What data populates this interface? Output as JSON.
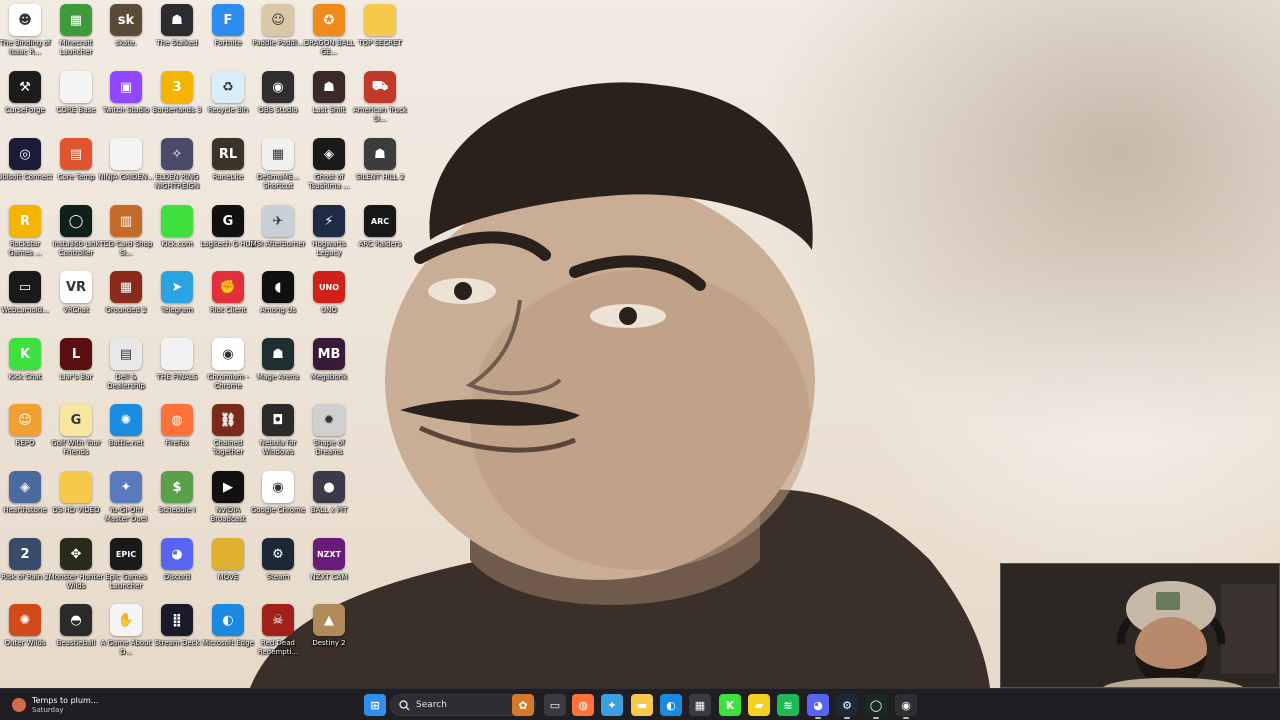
{
  "desktop": {
    "icons": [
      {
        "label": "The Binding of Isaac R...",
        "icon": "isaac-icon",
        "color": "#ffffff",
        "glyph": "☻"
      },
      {
        "label": "Minecraft Launcher",
        "icon": "minecraft-icon",
        "color": "#3e9a3a",
        "glyph": "▦"
      },
      {
        "label": "skate.",
        "icon": "skate-icon",
        "color": "#5a4a3a",
        "glyph": "sk"
      },
      {
        "label": "The Stalked",
        "icon": "stalked-icon",
        "color": "#2b2b30",
        "glyph": "☗"
      },
      {
        "label": "Fortnite",
        "icon": "fortnite-icon",
        "color": "#2d8cf0",
        "glyph": "F"
      },
      {
        "label": "Paddle Paddl...",
        "icon": "paddle-icon",
        "color": "#d8c8a8",
        "glyph": "☺"
      },
      {
        "label": "DRAGON BALL GE...",
        "icon": "dragonball-icon",
        "color": "#f08a1a",
        "glyph": "✪"
      },
      {
        "label": "TOP SECRET",
        "icon": "folder-icon",
        "color": "#f6c94a",
        "glyph": ""
      },
      {
        "label": "CurseForge",
        "icon": "curseforge-icon",
        "color": "#1c1c1c",
        "glyph": "⚒"
      },
      {
        "label": "CORE Base",
        "icon": "file-icon",
        "color": "#f4f4f4",
        "glyph": ""
      },
      {
        "label": "Twitch Studio",
        "icon": "twitch-icon",
        "color": "#9146ff",
        "glyph": "▣"
      },
      {
        "label": "Borderlands 3",
        "icon": "borderlands-icon",
        "color": "#f4b400",
        "glyph": "3"
      },
      {
        "label": "Recycle Bin",
        "icon": "recycle-bin-icon",
        "color": "#d9eef9",
        "glyph": "♻"
      },
      {
        "label": "OBS Studio",
        "icon": "obs-icon",
        "color": "#302e31",
        "glyph": "◉"
      },
      {
        "label": "Last Shift",
        "icon": "lastshift-icon",
        "color": "#3a2a2a",
        "glyph": "☗"
      },
      {
        "label": "American Truck Si...",
        "icon": "truck-icon",
        "color": "#c0392b",
        "glyph": "⛟"
      },
      {
        "label": "Ubisoft Connect",
        "icon": "ubisoft-icon",
        "color": "#1b1b3a",
        "glyph": "◎"
      },
      {
        "label": "Core Temp",
        "icon": "coretemp-icon",
        "color": "#e0542f",
        "glyph": "▤"
      },
      {
        "label": "NINJA GAIDEN...",
        "icon": "file-icon",
        "color": "#f4f4f4",
        "glyph": ""
      },
      {
        "label": "ELDEN RING NIGHTREIGN",
        "icon": "eldenring-icon",
        "color": "#4a4a6a",
        "glyph": "✧"
      },
      {
        "label": "RuneLite",
        "icon": "runelite-icon",
        "color": "#3a3328",
        "glyph": "RL"
      },
      {
        "label": "DeSmuME... Shortcut",
        "icon": "desmume-icon",
        "color": "#f0f0f0",
        "glyph": "▦"
      },
      {
        "label": "Ghost of Tsushima ...",
        "icon": "ghost-icon",
        "color": "#1a1a1a",
        "glyph": "◈"
      },
      {
        "label": "SILENT HILL 2",
        "icon": "silenthill-icon",
        "color": "#3c3c3c",
        "glyph": "☗"
      },
      {
        "label": "Rockstar Games ...",
        "icon": "rockstar-icon",
        "color": "#f4b400",
        "glyph": "R"
      },
      {
        "label": "Insta360 Link Controller",
        "icon": "insta360-icon",
        "color": "#0f1f1a",
        "glyph": "◯"
      },
      {
        "label": "TCG Card Shop Si...",
        "icon": "tcg-icon",
        "color": "#c46a2a",
        "glyph": "▥"
      },
      {
        "label": "Kick.com",
        "icon": "kick-icon",
        "color": "#3ee03e",
        "glyph": ""
      },
      {
        "label": "Logitech G HUB",
        "icon": "logitech-icon",
        "color": "#111111",
        "glyph": "G"
      },
      {
        "label": "MSI Afterburner",
        "icon": "msi-icon",
        "color": "#c8d0d8",
        "glyph": "✈"
      },
      {
        "label": "Hogwarts Legacy",
        "icon": "hogwarts-icon",
        "color": "#1f2a44",
        "glyph": "⚡"
      },
      {
        "label": "ARC Raiders",
        "icon": "arc-icon",
        "color": "#181818",
        "glyph": "ARC"
      },
      {
        "label": "Webcamoid...",
        "icon": "webcamoid-icon",
        "color": "#1a1a1a",
        "glyph": "▭"
      },
      {
        "label": "VRChat",
        "icon": "vrchat-icon",
        "color": "#ffffff",
        "glyph": "VR"
      },
      {
        "label": "Grounded 2",
        "icon": "grounded-icon",
        "color": "#8a2a1a",
        "glyph": "▦"
      },
      {
        "label": "Telegram",
        "icon": "telegram-icon",
        "color": "#2aa3e0",
        "glyph": "➤"
      },
      {
        "label": "Riot Client",
        "icon": "riot-icon",
        "color": "#e3313c",
        "glyph": "✊"
      },
      {
        "label": "Among Us",
        "icon": "amongus-icon",
        "color": "#101010",
        "glyph": "◖"
      },
      {
        "label": "UNO",
        "icon": "uno-icon",
        "color": "#d0201a",
        "glyph": "UNO"
      },
      {
        "label": "Kick Chat",
        "icon": "kickchat-icon",
        "color": "#3ee03e",
        "glyph": "K"
      },
      {
        "label": "Liar's Bar",
        "icon": "liarsbar-icon",
        "color": "#5a1010",
        "glyph": "L"
      },
      {
        "label": "Dell & Dealership",
        "icon": "dell-icon",
        "color": "#e8e8e8",
        "glyph": "▤"
      },
      {
        "label": "THE FINALS",
        "icon": "finals-icon",
        "color": "#f2f2f2",
        "glyph": ""
      },
      {
        "label": "Chromium - Chrome",
        "icon": "chromium-icon",
        "color": "#ffffff",
        "glyph": "◉"
      },
      {
        "label": "Mage Arena",
        "icon": "magearena-icon",
        "color": "#1f2f2f",
        "glyph": "☗"
      },
      {
        "label": "Megabonk",
        "icon": "megabonk-icon",
        "color": "#3a1a3a",
        "glyph": "MB"
      },
      {
        "label": "REPO",
        "icon": "repo-icon",
        "color": "#f0a030",
        "glyph": "☺"
      },
      {
        "label": "Golf With Your Friends",
        "icon": "golf-icon",
        "color": "#f7e7a0",
        "glyph": "G"
      },
      {
        "label": "Battle.net",
        "icon": "battlenet-icon",
        "color": "#1a8ce0",
        "glyph": "✺"
      },
      {
        "label": "Firefox",
        "icon": "firefox-icon",
        "color": "#ff7139",
        "glyph": "◍"
      },
      {
        "label": "Chained Together",
        "icon": "chained-icon",
        "color": "#7a2a1a",
        "glyph": "⛓"
      },
      {
        "label": "Nebula for Windows",
        "icon": "nebula-icon",
        "color": "#2a2a2a",
        "glyph": "◘"
      },
      {
        "label": "Shape of Dreams",
        "icon": "shape-icon",
        "color": "#d0d0d0",
        "glyph": "✹"
      },
      {
        "label": "Hearthstone",
        "icon": "hearthstone-icon",
        "color": "#4a6aa0",
        "glyph": "◈"
      },
      {
        "label": "DS HD VIDEO",
        "icon": "folder-icon",
        "color": "#f6c94a",
        "glyph": ""
      },
      {
        "label": "Yu-Gi-Oh! Master Duel",
        "icon": "yugioh-icon",
        "color": "#5a7ac0",
        "glyph": "✦"
      },
      {
        "label": "Schedule I",
        "icon": "schedule-icon",
        "color": "#5aa04a",
        "glyph": "$"
      },
      {
        "label": "NVIDIA Broadcast",
        "icon": "nvidia-icon",
        "color": "#111111",
        "glyph": "▶"
      },
      {
        "label": "Google Chrome",
        "icon": "chrome-icon",
        "color": "#ffffff",
        "glyph": "◉"
      },
      {
        "label": "BALL x PIT",
        "icon": "ballxpit-icon",
        "color": "#3a3a4a",
        "glyph": "●"
      },
      {
        "label": "Risk of Rain 2",
        "icon": "riskofrain-icon",
        "color": "#3a4a6a",
        "glyph": "2"
      },
      {
        "label": "Monster Hunter Wilds",
        "icon": "monsterhunter-icon",
        "color": "#2a2a1a",
        "glyph": "✥"
      },
      {
        "label": "Epic Games Launcher",
        "icon": "epic-icon",
        "color": "#1a1a1a",
        "glyph": "EPIC"
      },
      {
        "label": "Discord",
        "icon": "discord-icon",
        "color": "#5865f2",
        "glyph": "◕"
      },
      {
        "label": "MOVE",
        "icon": "folder-icon",
        "color": "#e0b030",
        "glyph": ""
      },
      {
        "label": "Steam",
        "icon": "steam-icon",
        "color": "#1b2838",
        "glyph": "⚙"
      },
      {
        "label": "NZXT CAM",
        "icon": "nzxt-icon",
        "color": "#6a1a7a",
        "glyph": "NZXT"
      },
      {
        "label": "Outer Wilds",
        "icon": "outerwilds-icon",
        "color": "#d04a1a",
        "glyph": "✺"
      },
      {
        "label": "Beastieball",
        "icon": "beastieball-icon",
        "color": "#2a2a2a",
        "glyph": "◓"
      },
      {
        "label": "A Game About D...",
        "icon": "agameabout-icon",
        "color": "#f4f4f4",
        "glyph": "✋"
      },
      {
        "label": "Stream Deck",
        "icon": "streamdeck-icon",
        "color": "#1a1a2a",
        "glyph": "⣿"
      },
      {
        "label": "Microsoft Edge",
        "icon": "edge-icon",
        "color": "#1a8ae0",
        "glyph": "◐"
      },
      {
        "label": "Red Dead Redempti...",
        "icon": "rdr-icon",
        "color": "#a0201a",
        "glyph": "☠"
      },
      {
        "label": "Destiny 2",
        "icon": "destiny-icon",
        "color": "#b08a5a",
        "glyph": "▲"
      }
    ]
  },
  "taskbar": {
    "weather": {
      "line1": "Temps to plum...",
      "line2": "Saturday"
    },
    "search_label": "Search",
    "pinned": [
      {
        "icon": "windows-start-icon",
        "color": "#2f8ff0",
        "glyph": "⊞"
      },
      {
        "icon": "widgets-icon",
        "color": "#d47a2a",
        "glyph": "✿"
      },
      {
        "icon": "task-view-icon",
        "color": "#3a3a40",
        "glyph": "▭"
      },
      {
        "icon": "firefox-icon",
        "color": "#ff7139",
        "glyph": "◍"
      },
      {
        "icon": "copilot-icon",
        "color": "#3aa0e0",
        "glyph": "✦"
      },
      {
        "icon": "file-explorer-icon",
        "color": "#f6c94a",
        "glyph": "▬"
      },
      {
        "icon": "edge-icon",
        "color": "#1a8ae0",
        "glyph": "◐"
      },
      {
        "icon": "store-icon",
        "color": "#3a3a40",
        "glyph": "▦"
      },
      {
        "icon": "kick-icon",
        "color": "#3ee03e",
        "glyph": "K"
      },
      {
        "icon": "sticky-notes-icon",
        "color": "#f4d020",
        "glyph": "▰"
      },
      {
        "icon": "spotify-icon",
        "color": "#1db954",
        "glyph": "≋"
      },
      {
        "icon": "discord-icon",
        "color": "#5865f2",
        "glyph": "◕"
      },
      {
        "icon": "steam-icon",
        "color": "#1b2838",
        "glyph": "⚙"
      },
      {
        "icon": "insta360-icon",
        "color": "#1a2a22",
        "glyph": "◯"
      },
      {
        "icon": "obs-icon",
        "color": "#302e31",
        "glyph": "◉"
      }
    ]
  }
}
